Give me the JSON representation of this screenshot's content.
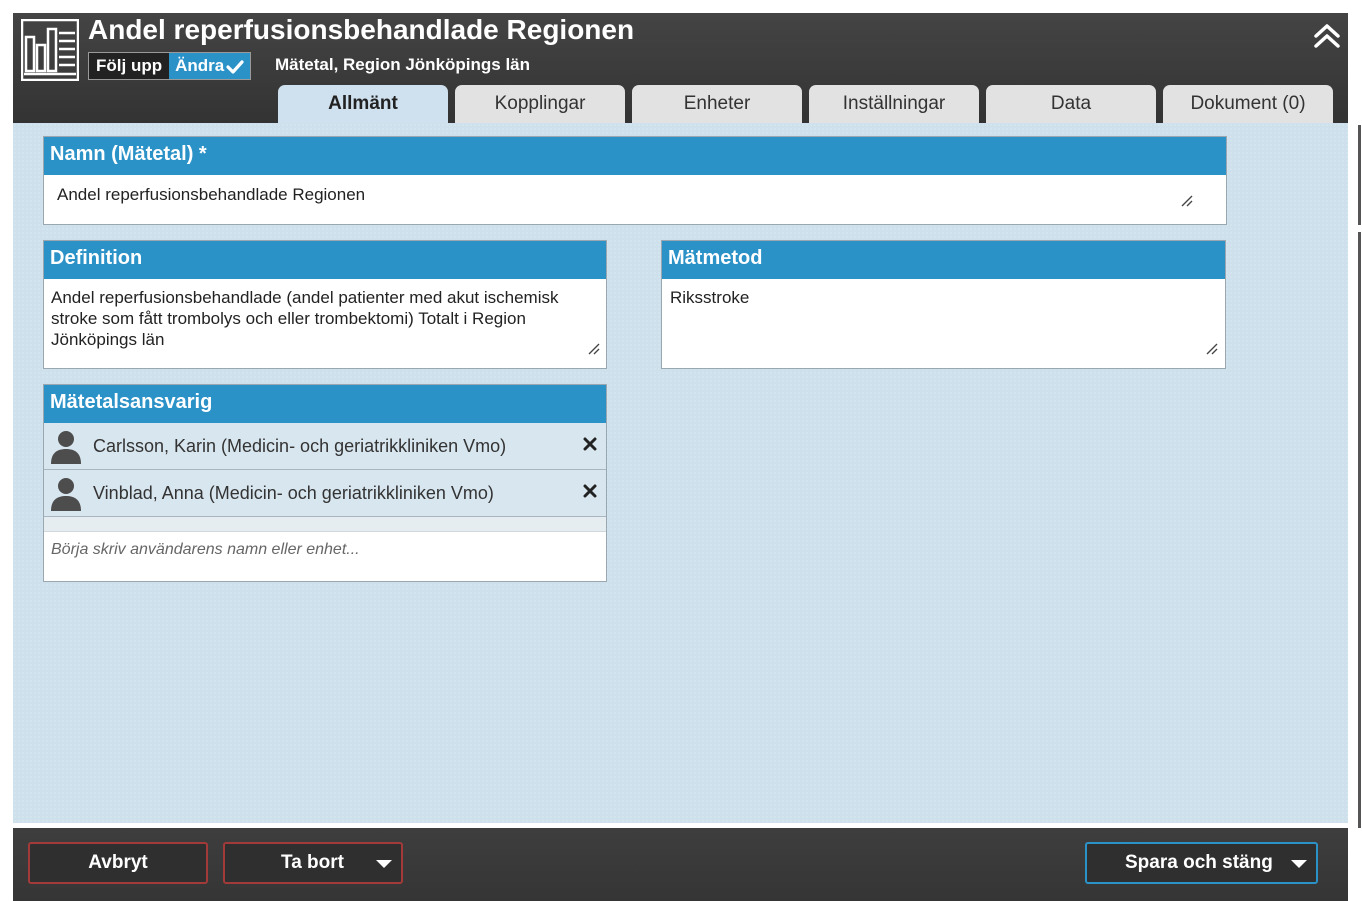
{
  "header": {
    "title": "Andel reperfusionsbehandlade Regionen",
    "mode_follow": "Följ upp",
    "mode_edit": "Ändra",
    "subtitle": "Mätetal, Region Jönköpings län"
  },
  "tabs": [
    {
      "label": "Allmänt",
      "active": true
    },
    {
      "label": "Kopplingar",
      "active": false
    },
    {
      "label": "Enheter",
      "active": false
    },
    {
      "label": "Inställningar",
      "active": false
    },
    {
      "label": "Data",
      "active": false
    },
    {
      "label": "Dokument (0)",
      "active": false
    }
  ],
  "name_panel": {
    "heading": "Namn (Mätetal) *",
    "value": "Andel reperfusionsbehandlade Regionen"
  },
  "definition_panel": {
    "heading": "Definition",
    "value": "Andel reperfusionsbehandlade (andel patienter med akut ischemisk stroke som fått trombolys och eller trombektomi) Totalt i Region Jönköpings län"
  },
  "method_panel": {
    "heading": "Mätmetod",
    "value": "Riksstroke"
  },
  "owner_panel": {
    "heading": "Mätetalsansvarig",
    "users": [
      "Carlsson, Karin (Medicin- och geriatrikkliniken Vmo)",
      "Vinblad, Anna (Medicin- och geriatrikkliniken Vmo)"
    ],
    "search_placeholder": "Börja skriv användarens namn eller enhet..."
  },
  "footer": {
    "cancel": "Avbryt",
    "delete": "Ta bort",
    "save": "Spara och stäng"
  },
  "colors": {
    "accent": "#2b92c8",
    "header_bg": "#3b3b3b",
    "content_bg": "#cde0ec",
    "danger_border": "#a33a3a"
  }
}
